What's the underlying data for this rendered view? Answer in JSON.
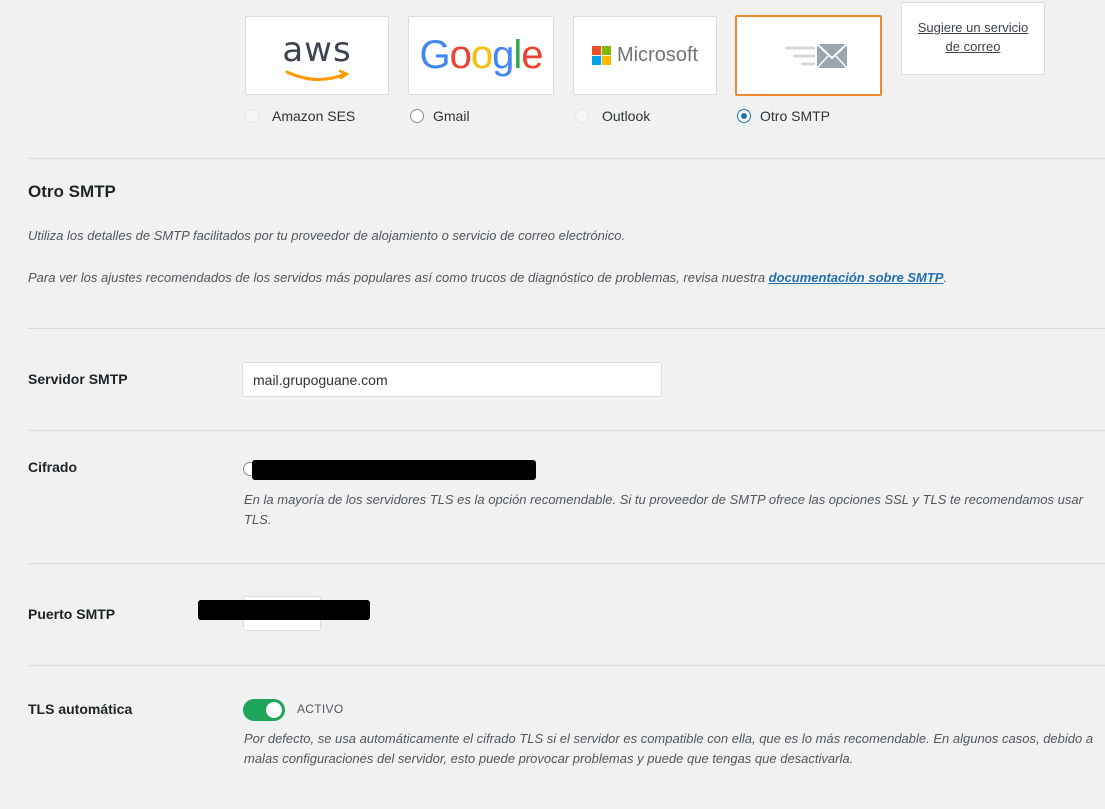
{
  "mailers": [
    {
      "id": "amazon",
      "label": "Amazon SES",
      "logo_text": "aws",
      "selected": false
    },
    {
      "id": "gmail",
      "label": "Gmail",
      "logo_text": "Google",
      "selected": false
    },
    {
      "id": "outlook",
      "label": "Outlook",
      "logo_text": "Microsoft",
      "selected": false
    },
    {
      "id": "smtp",
      "label": "Otro SMTP",
      "logo_text": "",
      "selected": true
    }
  ],
  "suggest": {
    "line1": "Sugiere un servicio",
    "line2": "de correo"
  },
  "section": {
    "title": "Otro SMTP",
    "desc1": "Utiliza los detalles de SMTP facilitados por tu proveedor de alojamiento o servicio de correo electrónico.",
    "desc2_prefix": "Para ver los ajustes recomendados de los servidos más populares así como trucos de diagnóstico de problemas, revisa nuestra ",
    "desc2_link": "documentación sobre SMTP",
    "desc2_suffix": "."
  },
  "fields": {
    "host": {
      "label": "Servidor SMTP",
      "value": "mail.grupoguane.com"
    },
    "encryption": {
      "label": "Cifrado",
      "help": "En la mayoría de los servidores TLS es la opción recomendable. Si tu proveedor de SMTP ofrece las opciones SSL y TLS te recomendamos usar TLS."
    },
    "port": {
      "label": "Puerto SMTP"
    },
    "autotls": {
      "label": "TLS automática",
      "toggle_text": "ACTIVO",
      "on": true,
      "help": "Por defecto, se usa automáticamente el cifrado TLS si el servidor es compatible con ella, que es lo más recomendable. En algunos casos, debido a malas configuraciones del servidor, esto puede provocar problemas y puede que tengas que desactivarla."
    }
  },
  "colors": {
    "accent": "#2271b1",
    "selected_border": "#f08a32",
    "toggle_on": "#1fa55a",
    "aws_orange": "#ff9900"
  }
}
